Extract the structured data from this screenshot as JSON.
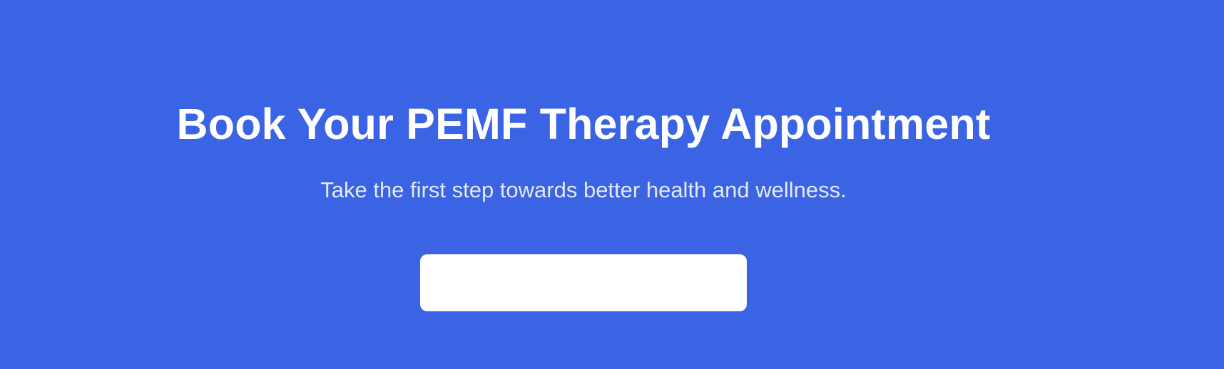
{
  "hero": {
    "title": "Book Your PEMF Therapy Appointment",
    "subtitle": "Take the first step towards better health and wellness.",
    "cta_label": ""
  },
  "colors": {
    "background": "#3a64e3",
    "title_text": "#ffffff",
    "subtitle_text": "#e4e9fb",
    "button_background": "#ffffff"
  }
}
